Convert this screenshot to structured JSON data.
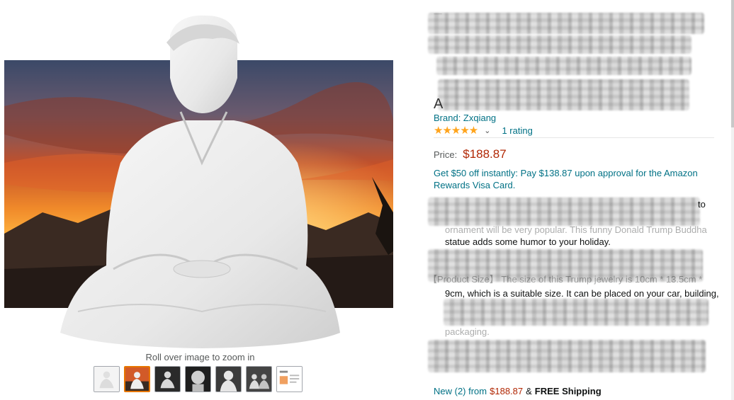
{
  "gallery": {
    "main_image_alt": "White statue of a seated meditating figure in robes in front of a sunset mountain landscape",
    "zoom_hint": "Roll over image to zoom in",
    "thumbnails": [
      {
        "name": "thumbnail-1",
        "selected": false
      },
      {
        "name": "thumbnail-2",
        "selected": true
      },
      {
        "name": "thumbnail-3",
        "selected": false
      },
      {
        "name": "thumbnail-4",
        "selected": false
      },
      {
        "name": "thumbnail-5",
        "selected": false
      },
      {
        "name": "thumbnail-6",
        "selected": false
      },
      {
        "name": "thumbnail-7",
        "selected": false
      }
    ]
  },
  "product": {
    "title_fragment_1": "T",
    "title_fragment_2": "A",
    "brand": "Brand: Zxqiang",
    "rating": {
      "stars": "★★★★★",
      "value": 5,
      "count_text": "1 rating"
    },
    "price_label": "Price:",
    "price": "$188.87",
    "promo": "Get $50 off instantly: Pay $138.87 upon approval for the Amazon Rewards Visa Card.",
    "bullets": {
      "b1_tail": "to",
      "b1_line2": "ornament will be very popular. This funny Donald Trump Buddha",
      "b1_line3": "statue adds some humor to your holiday.",
      "b2_line1": "【Product Size】 The size of this Trump jewelry is 10cm * 13.5cm *",
      "b2_line2": "9cm, which is a suitable size. It can be placed on your car, building,",
      "b2_line4": "packaging."
    },
    "offer": {
      "new_link": "New (2) from",
      "price": "$188.87",
      "amp": "&",
      "shipping": "FREE Shipping"
    }
  },
  "colors": {
    "link": "#007185",
    "price": "#b12704",
    "star": "#ffa41c",
    "selected_thumb": "#e77600"
  }
}
